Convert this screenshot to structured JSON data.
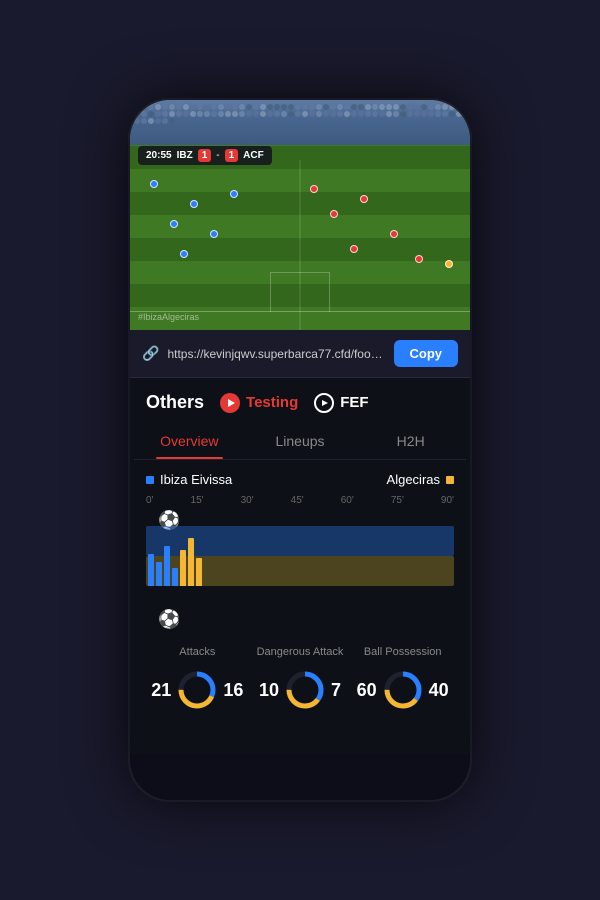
{
  "phone": {
    "video": {
      "score_time": "20:55",
      "team_home": "IBZ",
      "score_home": "1",
      "score_away": "1",
      "team_away": "ACF",
      "watermark": "#IbizaAlgeciras"
    },
    "url_bar": {
      "url": "https://kevinjqwv.superbarca77.cfd/football/spani...",
      "copy_label": "Copy",
      "icon": "🔗"
    },
    "sources": {
      "others_label": "Others",
      "testing_label": "Testing",
      "fef_label": "FEF"
    },
    "nav_tabs": [
      {
        "label": "Overview",
        "active": true
      },
      {
        "label": "Lineups",
        "active": false
      },
      {
        "label": "H2H",
        "active": false
      }
    ],
    "teams": {
      "home": "Ibiza Eivissa",
      "away": "Algeciras"
    },
    "timeline": {
      "labels": [
        "0'",
        "15'",
        "30'",
        "45'",
        "60'",
        "75'",
        "90'"
      ]
    },
    "stats": [
      {
        "label": "Attacks",
        "value_left": "21",
        "value_right": "16",
        "left_pct": 56,
        "right_pct": 44,
        "color_left": "#2a7fff",
        "color_right": "#f5b731"
      },
      {
        "label": "Dangerous Attack",
        "value_left": "10",
        "value_right": "7",
        "left_pct": 60,
        "right_pct": 40,
        "color_left": "#2a7fff",
        "color_right": "#f5b731"
      },
      {
        "label": "Ball Possession",
        "value_left": "60",
        "value_right": "40",
        "left_pct": 60,
        "right_pct": 40,
        "color_left": "#2a7fff",
        "color_right": "#f5b731"
      }
    ]
  }
}
